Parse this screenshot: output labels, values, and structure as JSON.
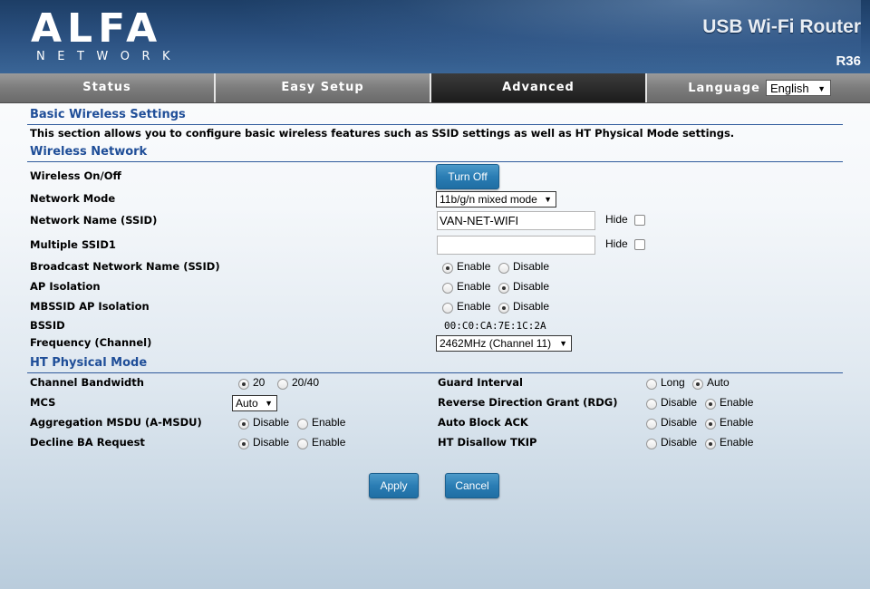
{
  "header": {
    "logo_text": "ALFA",
    "logo_subtext": "NETWORK",
    "product_name": "USB Wi-Fi Router",
    "model": "R36"
  },
  "nav": {
    "tabs": [
      {
        "label": "Status",
        "active": false
      },
      {
        "label": "Easy Setup",
        "active": false
      },
      {
        "label": "Advanced",
        "active": true
      }
    ],
    "language_label": "Language",
    "language_value": "English"
  },
  "basic": {
    "title": "Basic Wireless Settings",
    "description": "This section allows you to configure basic wireless features such as SSID settings as well as HT Physical Mode settings."
  },
  "wireless": {
    "title": "Wireless Network",
    "onoff_label": "Wireless On/Off",
    "onoff_button": "Turn Off",
    "mode_label": "Network Mode",
    "mode_value": "11b/g/n mixed mode",
    "ssid_label": "Network Name (SSID)",
    "ssid_value": "VAN-NET-WIFI",
    "ssid_hide": "Hide",
    "mssid_label": "Multiple SSID1",
    "mssid_value": "",
    "mssid_hide": "Hide",
    "broadcast_label": "Broadcast Network Name (SSID)",
    "ap_isolation_label": "AP Isolation",
    "mbssid_label": "MBSSID AP Isolation",
    "enable": "Enable",
    "disable": "Disable",
    "broadcast": "enable",
    "ap_isolation": "disable",
    "mbssid_isolation": "disable",
    "bssid_label": "BSSID",
    "bssid_value": "00:C0:CA:7E:1C:2A",
    "freq_label": "Frequency (Channel)",
    "freq_value": "2462MHz (Channel 11)"
  },
  "ht": {
    "title": "HT Physical Mode",
    "bandwidth_label": "Channel Bandwidth",
    "bw_20": "20",
    "bw_2040": "20/40",
    "bandwidth": "20",
    "mcs_label": "MCS",
    "mcs_value": "Auto",
    "amsdu_label": "Aggregation MSDU (A-MSDU)",
    "amsdu": "disable",
    "decline_label": "Decline BA Request",
    "decline": "disable",
    "guard_label": "Guard Interval",
    "guard_long": "Long",
    "guard_auto": "Auto",
    "guard": "auto",
    "rdg_label": "Reverse Direction Grant (RDG)",
    "rdg": "enable",
    "autoack_label": "Auto Block ACK",
    "autoack": "enable",
    "tkip_label": "HT Disallow TKIP",
    "tkip": "enable",
    "disable": "Disable",
    "enable": "Enable"
  },
  "actions": {
    "apply": "Apply",
    "cancel": "Cancel"
  },
  "colors": {
    "section_title": "#1f4e98",
    "button": "#2a7db4",
    "header_bg": "#2c5282"
  }
}
